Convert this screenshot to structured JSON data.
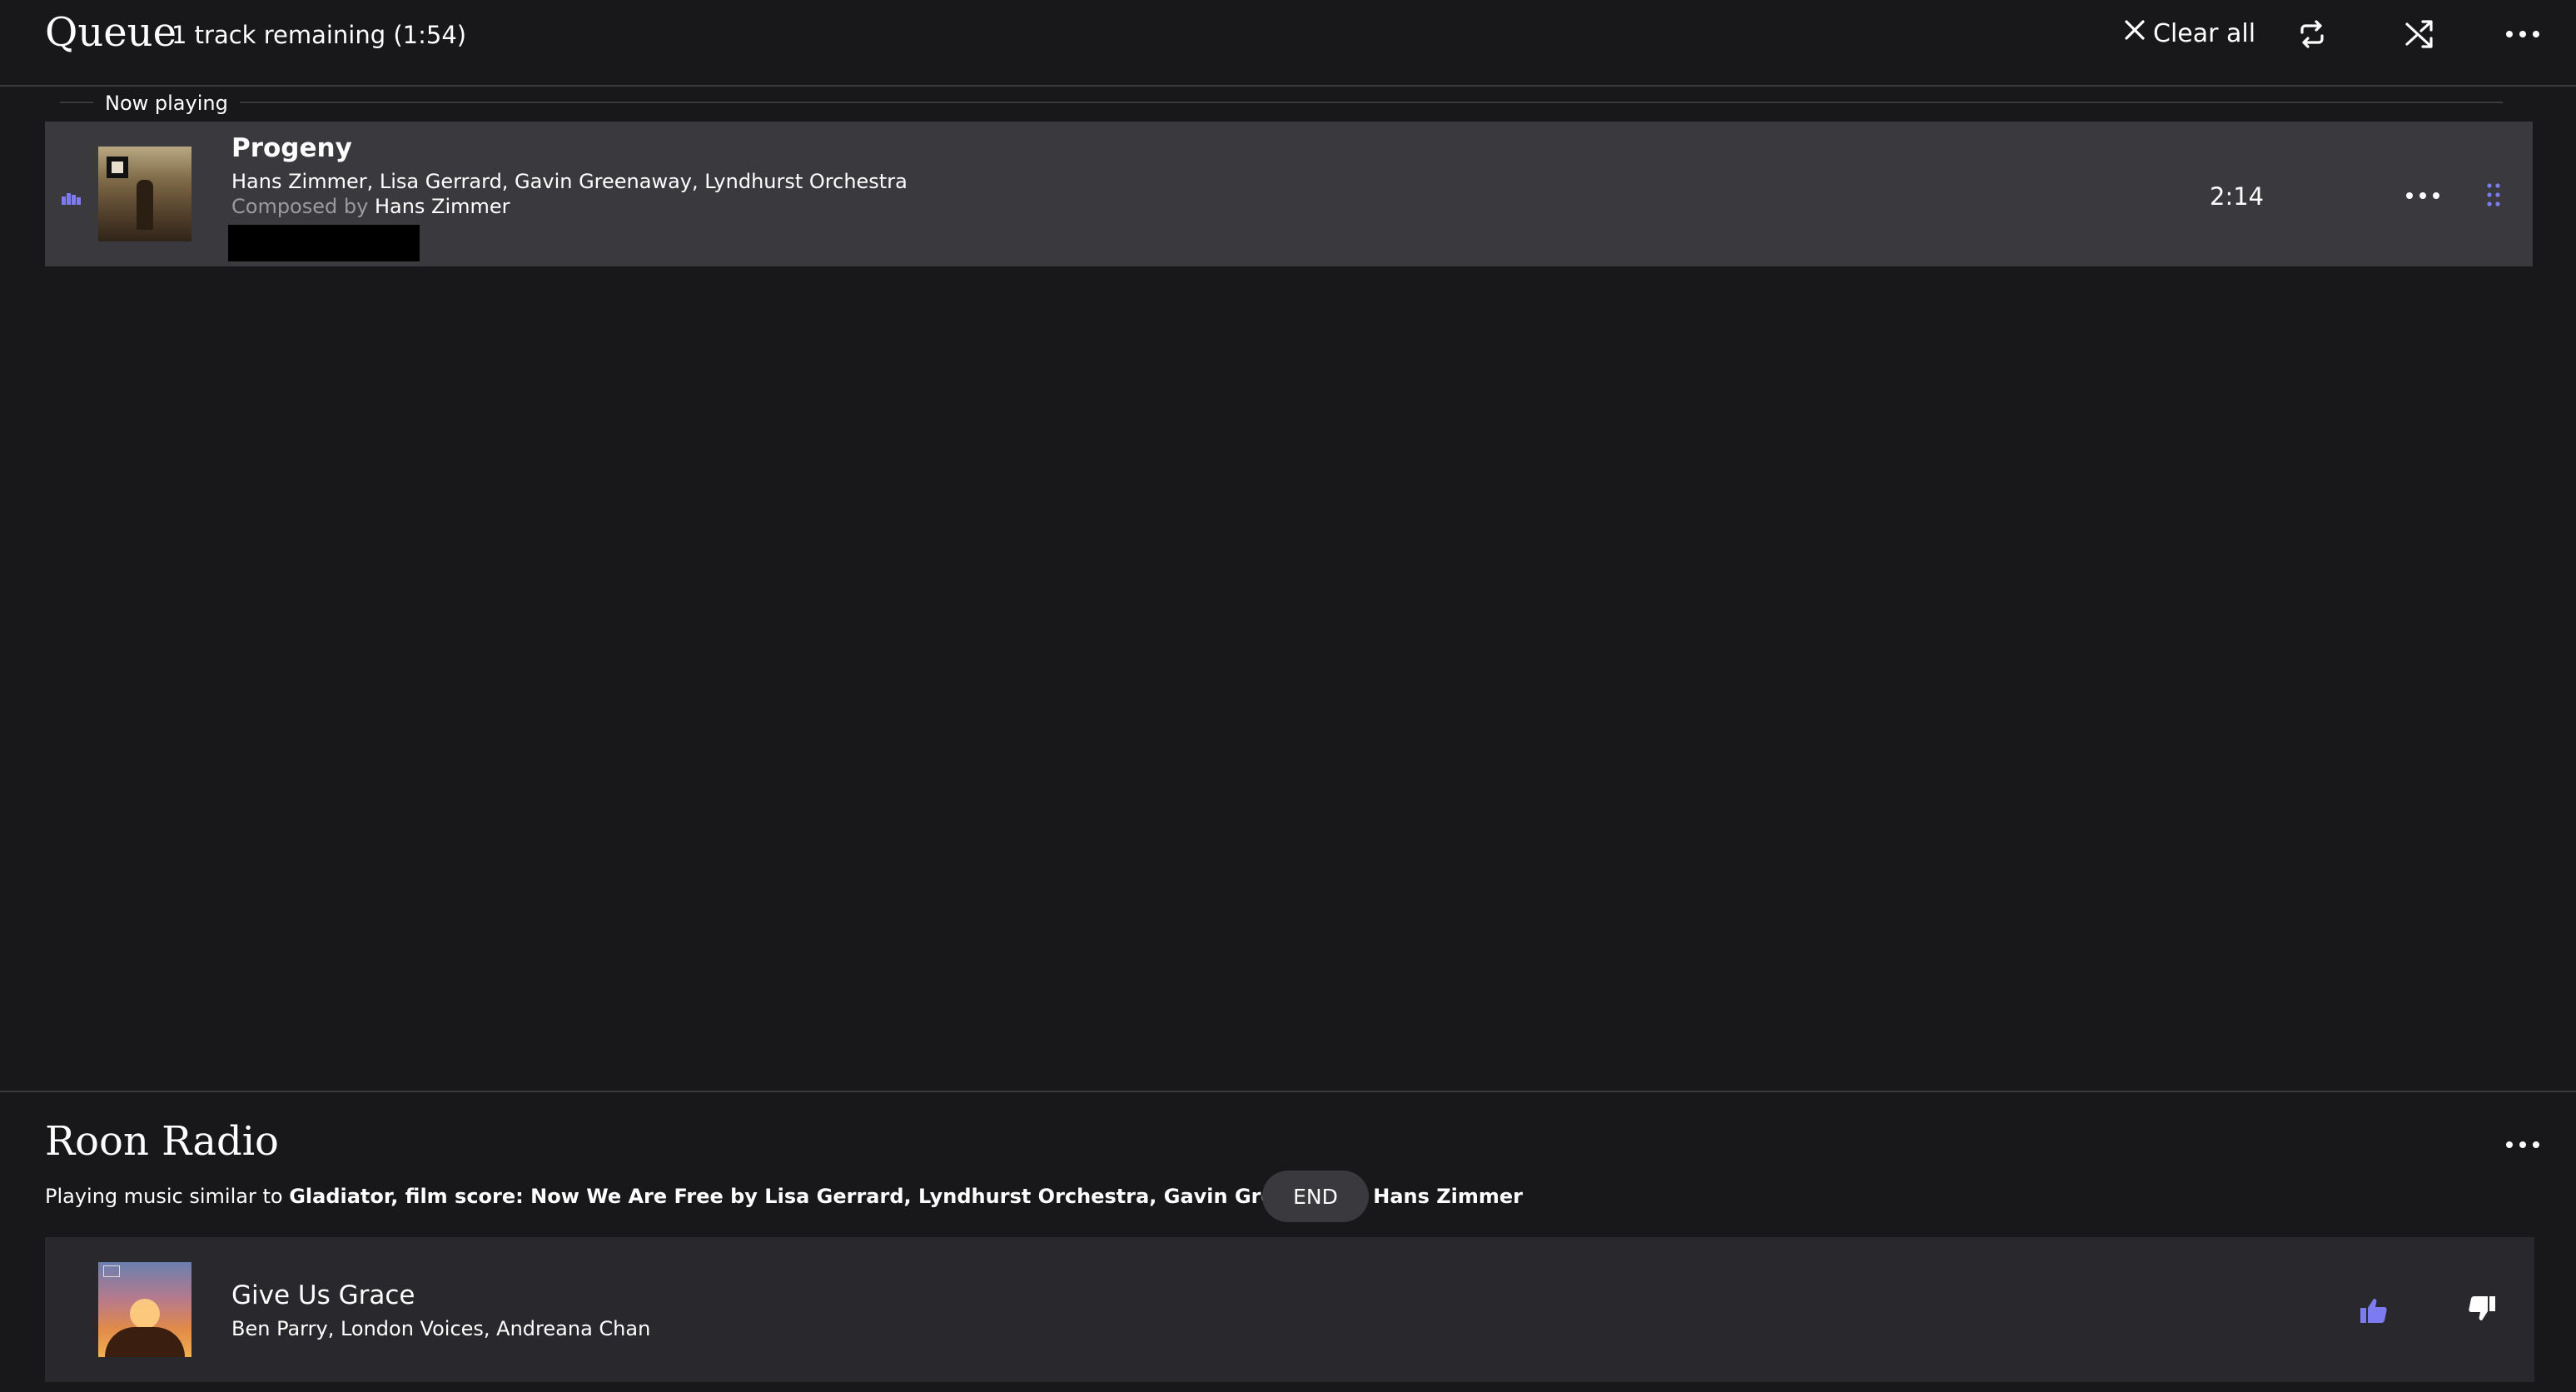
{
  "queue": {
    "title": "Queue",
    "subtitle": "1 track remaining (1:54)",
    "clear_all_label": "Clear all"
  },
  "now_playing": {
    "section_label": "Now playing",
    "track_title": "Progeny",
    "artists": "Hans Zimmer, Lisa Gerrard, Gavin Greenaway, Lyndhurst Orchestra",
    "composed_by_label": "Composed by",
    "composer": "Hans Zimmer",
    "duration": "2:14"
  },
  "radio": {
    "title": "Roon Radio",
    "desc_prefix": "Playing music similar to",
    "desc_subject": "Gladiator, film score: Now We Are Free by Lisa Gerrard, Lyndhurst Orchestra, Gavin Greenaway, Hans Zimmer",
    "end_label": "END",
    "next_track": {
      "title": "Give Us Grace",
      "artists": "Ben Parry, London Voices, Andreana Chan"
    }
  },
  "colors": {
    "background": "#18181a",
    "row_active": "#3a3a3e",
    "row_radio": "#29292d",
    "accent": "#7c7cf0",
    "text_muted": "#9a9aa0"
  },
  "icons": {
    "clear": "close-icon",
    "repeat": "repeat-icon",
    "shuffle": "shuffle-icon",
    "more": "more-horizontal-icon",
    "drag": "drag-handle-icon",
    "playing": "now-playing-indicator-icon",
    "thumbs_up": "thumbs-up-icon",
    "thumbs_down": "thumbs-down-icon"
  }
}
